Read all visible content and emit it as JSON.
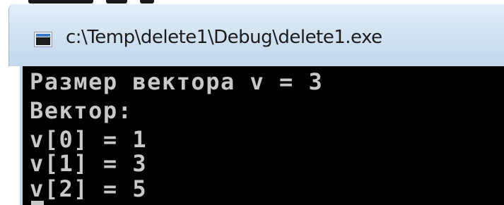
{
  "window": {
    "title": "c:\\Temp\\delete1\\Debug\\delete1.exe",
    "icon": "console-app-icon"
  },
  "console": {
    "lines": [
      "Размер вектора v = 3",
      "Вектор:",
      "v[0] = 1",
      "v[1] = 3",
      "v[2] = 5"
    ]
  },
  "colors": {
    "console_background": "#000000",
    "console_text": "#c8c8c8",
    "title_bar": "#d3e3f2"
  }
}
